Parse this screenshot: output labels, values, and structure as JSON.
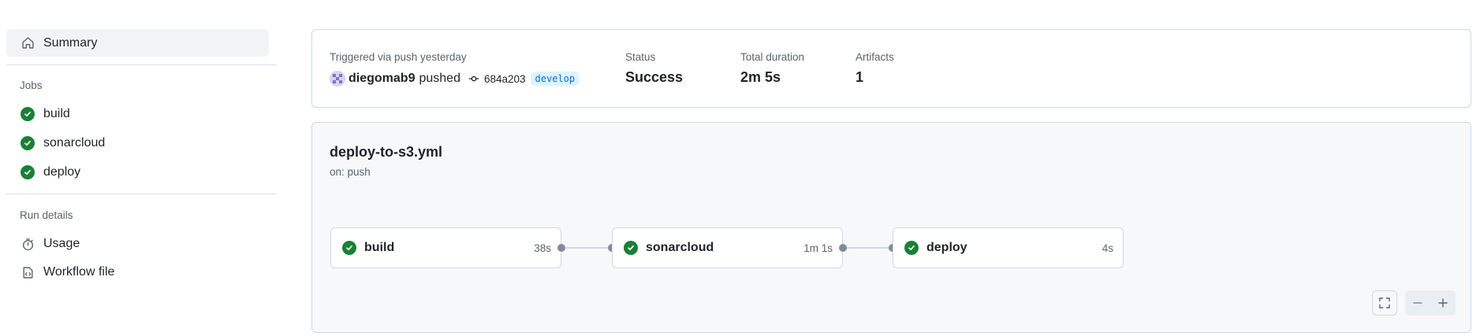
{
  "sidebar": {
    "summary_label": "Summary",
    "jobs_heading": "Jobs",
    "jobs": [
      {
        "label": "build",
        "status": "success"
      },
      {
        "label": "sonarcloud",
        "status": "success"
      },
      {
        "label": "deploy",
        "status": "success"
      }
    ],
    "run_details_heading": "Run details",
    "run_details": [
      {
        "label": "Usage",
        "icon": "stopwatch-icon"
      },
      {
        "label": "Workflow file",
        "icon": "file-code-icon"
      }
    ]
  },
  "summary": {
    "trigger_label": "Triggered via push yesterday",
    "actor": "diegomab9",
    "action": "pushed",
    "commit_sha": "684a203",
    "branch": "develop",
    "status_label": "Status",
    "status_value": "Success",
    "duration_label": "Total duration",
    "duration_value": "2m 5s",
    "artifacts_label": "Artifacts",
    "artifacts_value": "1"
  },
  "workflow": {
    "file_name": "deploy-to-s3.yml",
    "trigger": "on: push",
    "jobs": [
      {
        "name": "build",
        "duration": "38s"
      },
      {
        "name": "sonarcloud",
        "duration": "1m 1s"
      },
      {
        "name": "deploy",
        "duration": "4s"
      }
    ]
  },
  "colors": {
    "accent": "#0969da",
    "success": "#1a7f37",
    "muted_text": "#59636e",
    "border": "#d1d9e0"
  }
}
